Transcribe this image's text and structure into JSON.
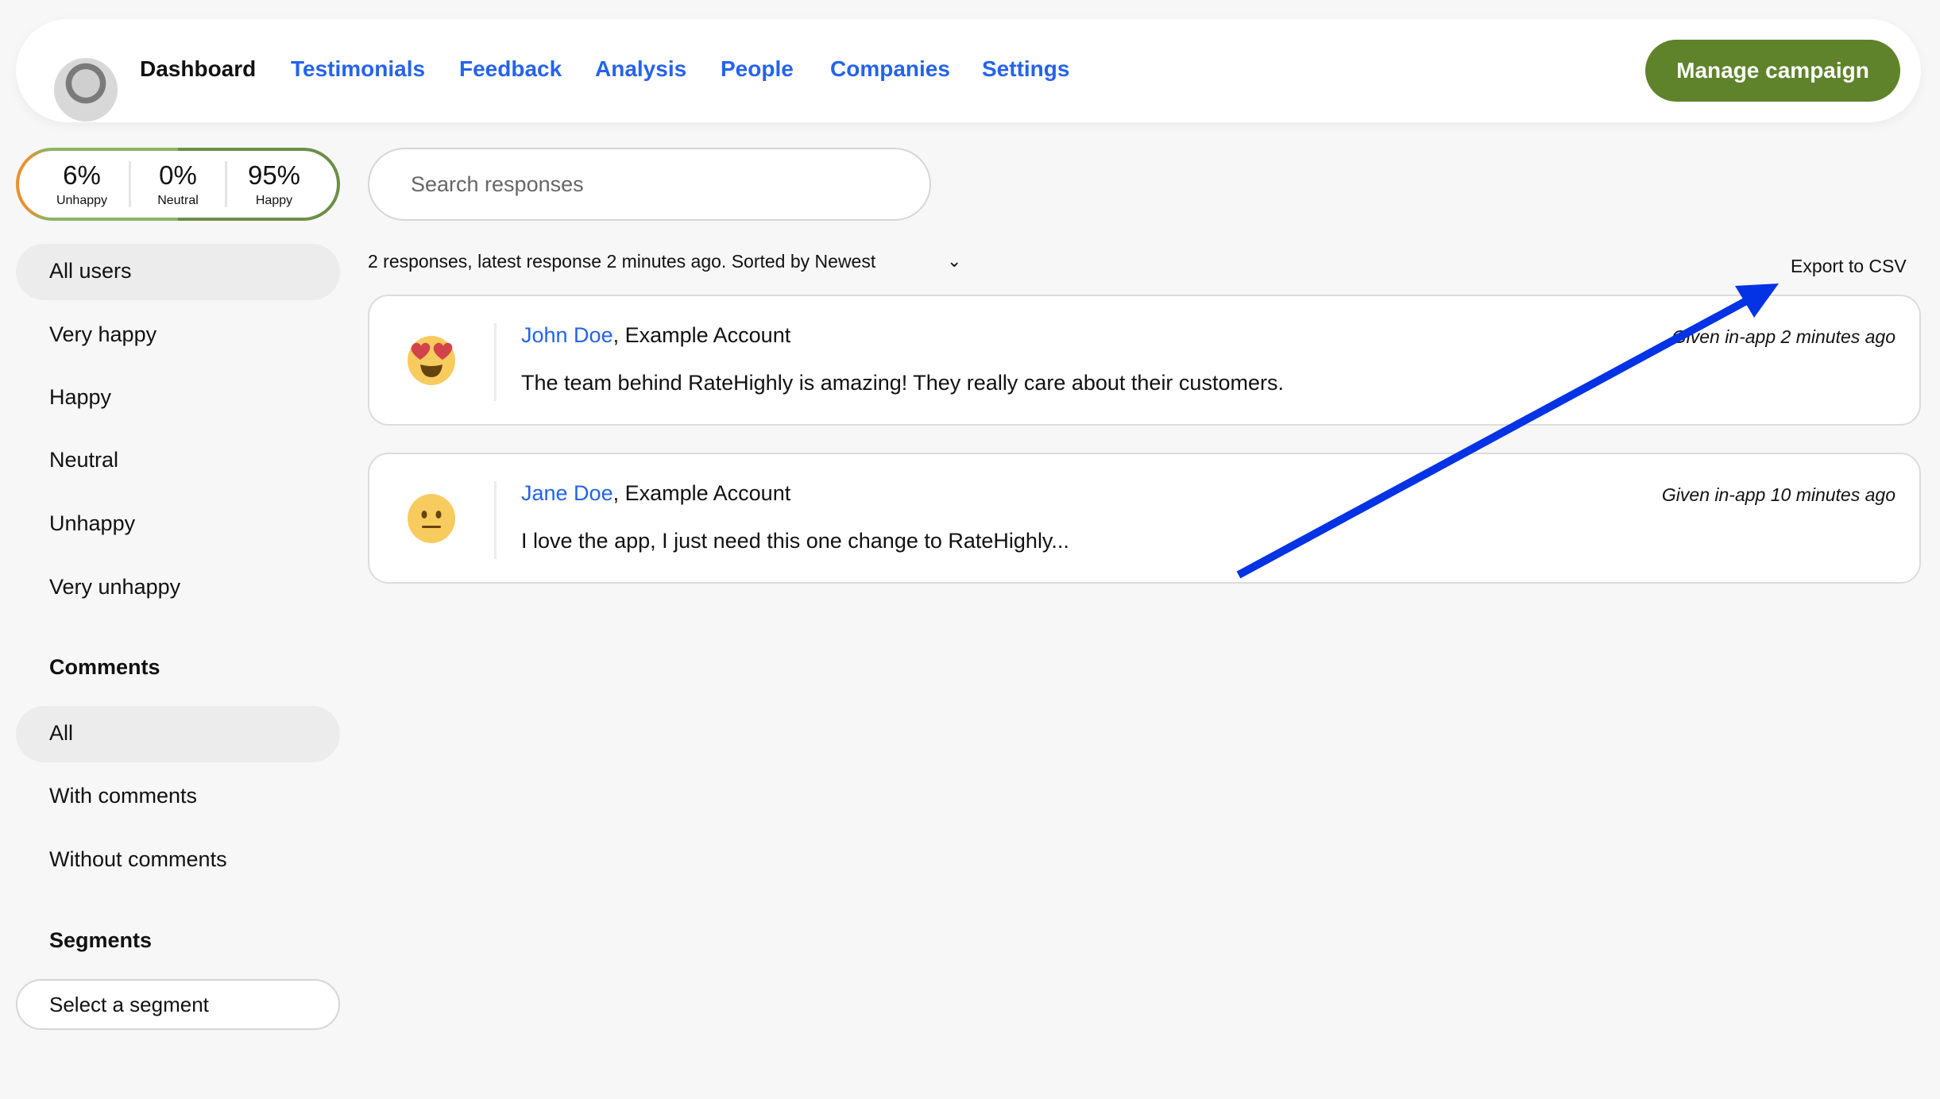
{
  "header": {
    "nav": [
      {
        "label": "Dashboard",
        "active": true
      },
      {
        "label": "Testimonials"
      },
      {
        "label": "Feedback"
      },
      {
        "label": "Analysis"
      },
      {
        "label": "People"
      },
      {
        "label": "Companies"
      },
      {
        "label": "Settings"
      }
    ],
    "manage_label": "Manage campaign"
  },
  "stats": [
    {
      "value": "6%",
      "label": "Unhappy"
    },
    {
      "value": "0%",
      "label": "Neutral"
    },
    {
      "value": "95%",
      "label": "Happy"
    }
  ],
  "search": {
    "placeholder": "Search responses"
  },
  "summary": "2 responses, latest response 2 minutes ago. Sorted by Newest",
  "export_label": "Export to CSV",
  "sidebar": {
    "filters": [
      "All users",
      "Very happy",
      "Happy",
      "Neutral",
      "Unhappy",
      "Very unhappy"
    ],
    "comments_heading": "Comments",
    "comments": [
      "All",
      "With comments",
      "Without comments"
    ],
    "segments_heading": "Segments",
    "segment_placeholder": "Select a segment"
  },
  "responses": [
    {
      "name": "John Doe",
      "account": ", Example Account",
      "text": "The team behind RateHighly is amazing! They really care about their customers.",
      "when": "Given in-app 2 minutes ago",
      "emoji": "heart-eyes"
    },
    {
      "name": "Jane Doe",
      "account": ", Example Account",
      "text": "I love the app, I just need this one change to RateHighly...",
      "when": "Given in-app 10 minutes ago",
      "emoji": "neutral-face"
    }
  ],
  "colors": {
    "accent": "#2563eb",
    "button": "#5e832b",
    "annotation_arrow": "#0433e6"
  }
}
